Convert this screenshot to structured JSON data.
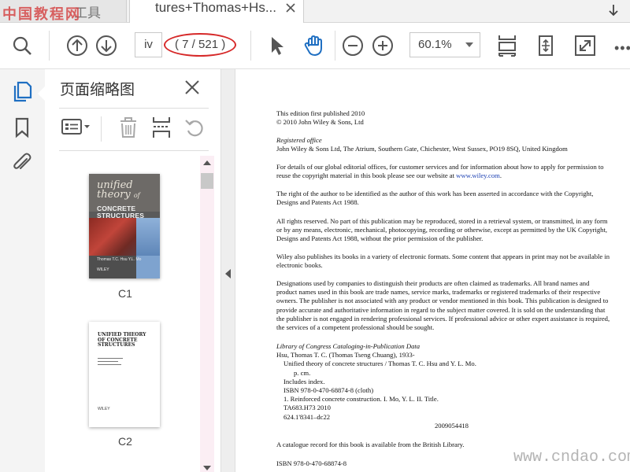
{
  "watermarks": {
    "top_left": "中国教程网",
    "bottom_right": "www.cndao.com"
  },
  "tabs": [
    {
      "label": "工具",
      "active": false
    },
    {
      "label": "tures+Thomas+Hs...",
      "active": true
    }
  ],
  "toolbar": {
    "page_input_value": "iv",
    "page_count": "( 7 / 521 )",
    "zoom_value": "60.1%",
    "more_label": "•••"
  },
  "panel": {
    "title": "页面缩略图",
    "thumbnails": [
      {
        "label": "C1",
        "cover_title_italic": [
          "unified",
          "theory",
          "of"
        ],
        "cover_title_bold": [
          "CONCRETE",
          "STRUCTURES"
        ],
        "cover_authors": "Thomas T.C. Hsu     Y.L. Mo",
        "cover_publisher": "WILEY"
      },
      {
        "label": "C2",
        "page_title": [
          "UNIFIED THEORY",
          "OF CONCRETE",
          "STRUCTURES"
        ],
        "page_publisher": "WILEY"
      }
    ]
  },
  "document": {
    "paragraphs": [
      {
        "lines": [
          "This edition first published 2010",
          "© 2010 John Wiley & Sons, Ltd"
        ]
      },
      {
        "italic_heading": "Registered office",
        "lines": [
          "John Wiley & Sons Ltd, The Atrium, Southern Gate, Chichester, West Sussex, PO19 8SQ, United Kingdom"
        ]
      },
      {
        "text": "For details of our global editorial offices, for customer services and for information about how to apply for permission to reuse the copyright material in this book please see our website at ",
        "link": "www.wiley.com",
        "after": "."
      },
      {
        "text": "The right of the author to be identified as the author of this work has been asserted in accordance with the Copyright, Designs and Patents Act 1988."
      },
      {
        "text": "All rights reserved. No part of this publication may be reproduced, stored in a retrieval system, or transmitted, in any form or by any means, electronic, mechanical, photocopying, recording or otherwise, except as permitted by the UK Copyright, Designs and Patents Act 1988, without the prior permission of the publisher."
      },
      {
        "text": "Wiley also publishes its books in a variety of electronic formats. Some content that appears in print may not be available in electronic books."
      },
      {
        "text": "Designations used by companies to distinguish their products are often claimed as trademarks. All brand names and product names used in this book are trade names, service marks, trademarks or registered trademarks of their respective owners. The publisher is not associated with any product or vendor mentioned in this book. This publication is designed to provide accurate and authoritative information in regard to the subject matter covered. It is sold on the understanding that the publisher is not engaged in rendering professional services. If professional advice or other expert assistance is required, the services of a competent professional should be sought."
      },
      {
        "italic_heading": "Library of Congress Cataloging-in-Publication Data",
        "lines": [
          "Hsu, Thomas T. C. (Thomas Tseng Chuang), 1933-"
        ],
        "indent1": [
          "Unified theory of concrete structures / Thomas T. C. Hsu and Y. L. Mo."
        ],
        "indent2": [
          "p. cm."
        ],
        "indent1b": [
          "Includes index.",
          "ISBN 978-0-470-68874-8 (cloth)",
          "1. Reinforced concrete construction.    I. Mo, Y. L.    II. Title.",
          "TA683.H73 2010",
          "624.1'8341–dc22"
        ],
        "right": "2009054418"
      },
      {
        "text": "A catalogue record for this book is available from the British Library."
      },
      {
        "text": "ISBN  978-0-470-68874-8"
      }
    ]
  }
}
